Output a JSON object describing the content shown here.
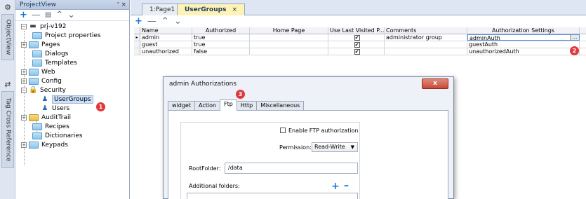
{
  "vstrip": {
    "tab1": "ObjectView",
    "tab2": "Tag Cross Reference"
  },
  "projectview": {
    "title": "ProjectView",
    "pin": "( ×",
    "tree": [
      {
        "label": "prj-v192",
        "expander": "−"
      },
      {
        "label": "Project properties"
      },
      {
        "label": "Pages",
        "expander": "+"
      },
      {
        "label": "Dialogs"
      },
      {
        "label": "Templates"
      },
      {
        "label": "Web",
        "expander": "+"
      },
      {
        "label": "Config",
        "expander": "+"
      },
      {
        "label": "Security",
        "expander": "−"
      },
      {
        "label": "UserGroups"
      },
      {
        "label": "Users"
      },
      {
        "label": "AuditTrail",
        "expander": "+"
      },
      {
        "label": "Recipes"
      },
      {
        "label": "Dictionaries"
      },
      {
        "label": "Keypads",
        "expander": "+"
      }
    ]
  },
  "badges": {
    "b1": "1",
    "b2": "2",
    "b3": "3"
  },
  "editor": {
    "tabs": [
      {
        "label": "1:Page1"
      },
      {
        "label": "UserGroups",
        "close": "×"
      }
    ],
    "columns": [
      "Name",
      "Authorized",
      "Home Page",
      "Use Last Visited P...",
      "Comments",
      "Authorization Settings"
    ],
    "rows": [
      {
        "name": "admin",
        "authorized": "true",
        "home": "",
        "last": "✔",
        "comments": "administrator group",
        "auth": "adminAuth"
      },
      {
        "name": "guest",
        "authorized": "true",
        "home": "",
        "last": "✔",
        "comments": "",
        "auth": "guestAuth"
      },
      {
        "name": "unauthorized",
        "authorized": "false",
        "home": "",
        "last": "✔",
        "comments": "",
        "auth": "unauthorizedAuth"
      }
    ],
    "ellipsis": "..."
  },
  "dialog": {
    "title": "admin Authorizations",
    "close": "x",
    "tabs": [
      "widget",
      "Action",
      "Ftp",
      "Http",
      "Miscellaneous"
    ],
    "enable_ftp_label": "Enable FTP authorization",
    "permission_label": "Permission:",
    "permission_value": "Read-Write",
    "rootfolder_label": "RootFolder:",
    "rootfolder_value": "/data",
    "additional_label": "Additional folders:"
  }
}
